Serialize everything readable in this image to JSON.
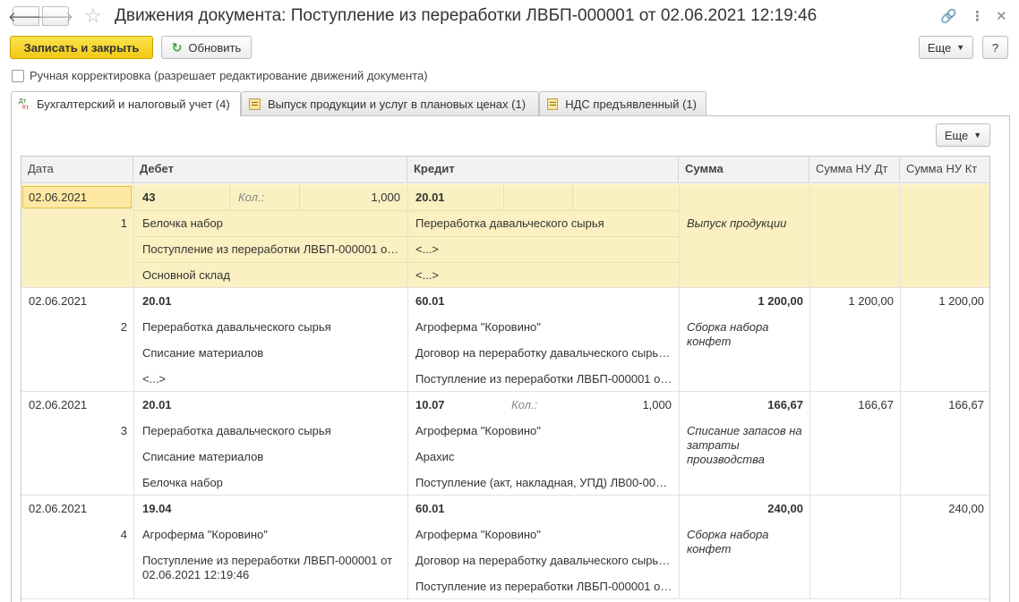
{
  "window": {
    "title": "Движения документа: Поступление из переработки ЛВБП-000001 от 02.06.2021 12:19:46"
  },
  "toolbar": {
    "save_close": "Записать и закрыть",
    "refresh": "Обновить",
    "more": "Еще",
    "help": "?"
  },
  "manual_adjust_label": "Ручная корректировка (разрешает редактирование движений документа)",
  "tabs": [
    {
      "label": "Бухгалтерский и налоговый учет (4)"
    },
    {
      "label": "Выпуск продукции и услуг в плановых ценах (1)"
    },
    {
      "label": "НДС предъявленный (1)"
    }
  ],
  "table_more": "Еще",
  "columns": {
    "date": "Дата",
    "debit": "Дебет",
    "credit": "Кредит",
    "sum": "Сумма",
    "sum_nu_dt": "Сумма НУ Дт",
    "sum_nu_kt": "Сумма НУ Кт"
  },
  "entries": [
    {
      "date": "02.06.2021",
      "num": "1",
      "debit_account": "43",
      "debit_qty_label": "Кол.:",
      "debit_qty": "1,000",
      "debit_sub": [
        "Белочка набор",
        "Поступление из переработки ЛВБП-000001 от…",
        "Основной склад"
      ],
      "credit_account": "20.01",
      "credit_qty_label": "",
      "credit_qty": "",
      "credit_sub": [
        "Переработка давальческого сырья",
        "<...>",
        "<...>"
      ],
      "sum": "",
      "content": "Выпуск продукции",
      "sum_nu_dt": "",
      "sum_nu_kt": ""
    },
    {
      "date": "02.06.2021",
      "num": "2",
      "debit_account": "20.01",
      "debit_qty_label": "",
      "debit_qty": "",
      "debit_sub": [
        "Переработка давальческого сырья",
        "Списание материалов",
        "<...>"
      ],
      "credit_account": "60.01",
      "credit_qty_label": "",
      "credit_qty": "",
      "credit_sub": [
        "Агроферма \"Коровино\"",
        "Договор на переработку давальческого сырь…",
        "Поступление из переработки ЛВБП-000001 о…"
      ],
      "sum": "1 200,00",
      "content": "Сборка набора конфет",
      "sum_nu_dt": "1 200,00",
      "sum_nu_kt": "1 200,00"
    },
    {
      "date": "02.06.2021",
      "num": "3",
      "debit_account": "20.01",
      "debit_qty_label": "",
      "debit_qty": "",
      "debit_sub": [
        "Переработка давальческого сырья",
        "Списание материалов",
        "Белочка набор"
      ],
      "credit_account": "10.07",
      "credit_qty_label": "Кол.:",
      "credit_qty": "1,000",
      "credit_sub": [
        "Агроферма \"Коровино\"",
        "Арахис",
        "Поступление (акт, накладная, УПД) ЛВ00-000…"
      ],
      "sum": "166,67",
      "content": "Списание запасов на затраты производства",
      "sum_nu_dt": "166,67",
      "sum_nu_kt": "166,67"
    },
    {
      "date": "02.06.2021",
      "num": "4",
      "debit_account": "19.04",
      "debit_qty_label": "",
      "debit_qty": "",
      "debit_sub": [
        "Агроферма \"Коровино\"",
        "Поступление из переработки ЛВБП-000001 от 02.06.2021 12:19:46",
        ""
      ],
      "credit_account": "60.01",
      "credit_qty_label": "",
      "credit_qty": "",
      "credit_sub": [
        "Агроферма \"Коровино\"",
        "Договор на переработку давальческого сырь…",
        "Поступление из переработки ЛВБП-000001 о…"
      ],
      "sum": "240,00",
      "content": "Сборка набора конфет",
      "sum_nu_dt": "",
      "sum_nu_kt": "240,00"
    }
  ]
}
